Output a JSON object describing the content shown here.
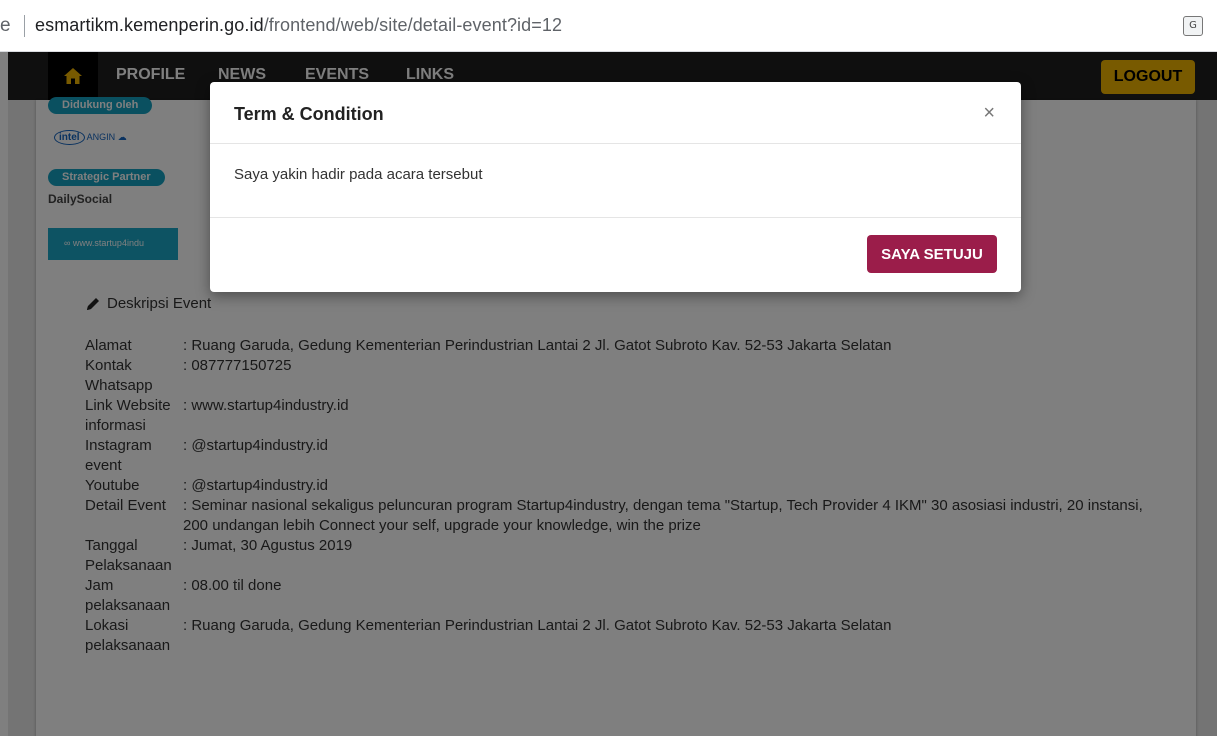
{
  "browser": {
    "address_prefix": "e",
    "url_host": "esmartikm.kemenperin.go.id",
    "url_path": "/frontend/web/site/detail-event?id=12"
  },
  "nav": {
    "items": [
      "PROFILE",
      "NEWS",
      "EVENTS",
      "LINKS"
    ],
    "logout": "LOGOUT"
  },
  "poster": {
    "supported_by": "Didukung oleh",
    "strategic_partner": "Strategic Partner",
    "daily_social": "DailySocial",
    "link": "www.startup4indu"
  },
  "description": {
    "title": "Deskripsi Event",
    "rows": [
      {
        "label": "Alamat",
        "value": ": Ruang Garuda, Gedung Kementerian Perindustrian Lantai 2 Jl. Gatot Subroto Kav. 52-53 Jakarta Selatan"
      },
      {
        "label": "Kontak Whatsapp",
        "value": ": 087777150725"
      },
      {
        "label": "Link Website informasi",
        "value": ": www.startup4industry.id"
      },
      {
        "label": "Instagram event",
        "value": ": @startup4industry.id"
      },
      {
        "label": "Youtube",
        "value": ": @startup4industry.id"
      },
      {
        "label": "Detail Event",
        "value": ": Seminar nasional sekaligus peluncuran program Startup4industry, dengan tema \"Startup, Tech Provider 4 IKM\" 30 asosiasi industri, 20 instansi, 200 undangan lebih Connect your self, upgrade your knowledge, win the prize"
      },
      {
        "label": "Tanggal Pelaksanaan",
        "value": ": Jumat, 30 Agustus 2019"
      },
      {
        "label": "Jam pelaksanaan",
        "value": ": 08.00 til done"
      },
      {
        "label": "Lokasi pelaksanaan",
        "value": ": Ruang Garuda, Gedung Kementerian Perindustrian Lantai 2 Jl. Gatot Subroto Kav. 52-53 Jakarta Selatan"
      }
    ]
  },
  "modal": {
    "title": "Term & Condition",
    "close": "×",
    "body": "Saya yakin hadir pada acara tersebut",
    "agree_button": "SAYA SETUJU"
  }
}
